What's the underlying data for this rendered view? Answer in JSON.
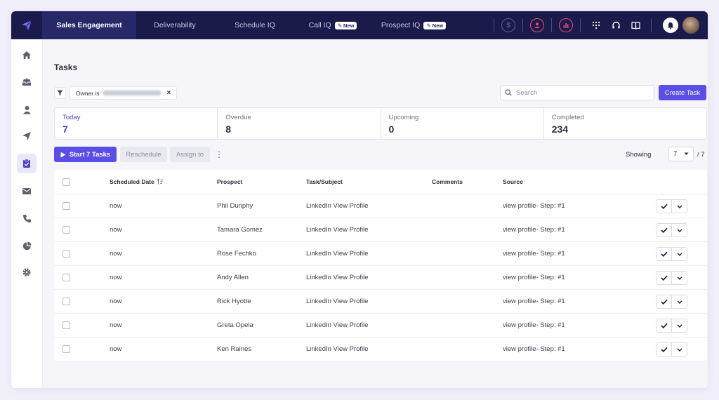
{
  "colors": {
    "nav_bg": "#1a1b4b",
    "accent": "#5b4ee6",
    "active_stat": "#4c44c8"
  },
  "nav": {
    "tabs": [
      {
        "label": "Sales Engagement",
        "badge": ""
      },
      {
        "label": "Deliverability",
        "badge": ""
      },
      {
        "label": "Schedule IQ",
        "badge": ""
      },
      {
        "label": "Call IQ",
        "badge": "New"
      },
      {
        "label": "Prospect IQ",
        "badge": "New"
      }
    ]
  },
  "page": {
    "title": "Tasks"
  },
  "filter": {
    "owner_label": "Owner is"
  },
  "search": {
    "placeholder": "Search"
  },
  "toolbar": {
    "create_task": "Create Task",
    "start_tasks": "Start 7 Tasks",
    "reschedule": "Reschedule",
    "assign_to": "Assign to",
    "showing_label": "Showing",
    "page_size": "7",
    "total": "/ 7"
  },
  "stats": [
    {
      "label": "Today",
      "value": "7"
    },
    {
      "label": "Overdue",
      "value": "8"
    },
    {
      "label": "Upcoming",
      "value": "0"
    },
    {
      "label": "Completed",
      "value": "234"
    }
  ],
  "table": {
    "columns": [
      "Scheduled Date",
      "Prospect",
      "Task/Subject",
      "Comments",
      "Source"
    ],
    "rows": [
      {
        "date": "now",
        "prospect": "Phil Dunphy",
        "task": "LinkedIn View Profile",
        "comments": "",
        "source": "view profile- Step: #1"
      },
      {
        "date": "now",
        "prospect": "Tamara Gomez",
        "task": "LinkedIn View Profile",
        "comments": "",
        "source": "view profile- Step: #1"
      },
      {
        "date": "now",
        "prospect": "Rose Fechko",
        "task": "LinkedIn View Profile",
        "comments": "",
        "source": "view profile- Step: #1"
      },
      {
        "date": "now",
        "prospect": "Andy Allen",
        "task": "LinkedIn View Profile",
        "comments": "",
        "source": "view profile- Step: #1"
      },
      {
        "date": "now",
        "prospect": "Rick Hyotte",
        "task": "LinkedIn View Profile",
        "comments": "",
        "source": "view profile- Step: #1"
      },
      {
        "date": "now",
        "prospect": "Greta Opela",
        "task": "LinkedIn View Profile",
        "comments": "",
        "source": "view profile- Step: #1"
      },
      {
        "date": "now",
        "prospect": "Ken Raines",
        "task": "LinkedIn View Profile",
        "comments": "",
        "source": "view profile- Step: #1"
      }
    ]
  }
}
